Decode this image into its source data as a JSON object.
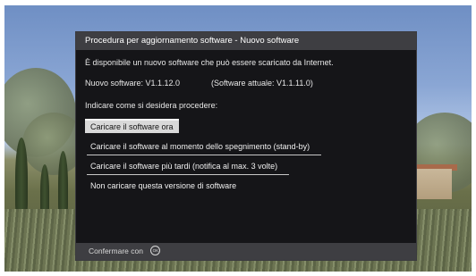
{
  "dialog": {
    "title": "Procedura per aggiornamento software - Nuovo software",
    "message": "È disponibile un nuovo software che può essere scaricato da Internet.",
    "new_version_label": "Nuovo software:  V1.1.12.0",
    "current_version_label": "(Software attuale:  V1.1.11.0)",
    "prompt": "Indicare come si desidera procedere:",
    "options": [
      {
        "label": "Caricare il software ora",
        "selected": true
      },
      {
        "label": "Caricare il software al momento dello spegnimento (stand-by)",
        "selected": false
      },
      {
        "label": "Caricare il software più tardi (notifica al max. 3 volte)",
        "selected": false
      },
      {
        "label": "Non caricare questa versione di software",
        "selected": false
      }
    ],
    "footer": {
      "confirm_label": "Confermare con",
      "icon": "ok-button-icon",
      "icon_text": "OK"
    }
  },
  "colors": {
    "dialog_bg": "#151518",
    "title_bar": "#3e3e42",
    "selected_option": "#d9d9d9"
  }
}
